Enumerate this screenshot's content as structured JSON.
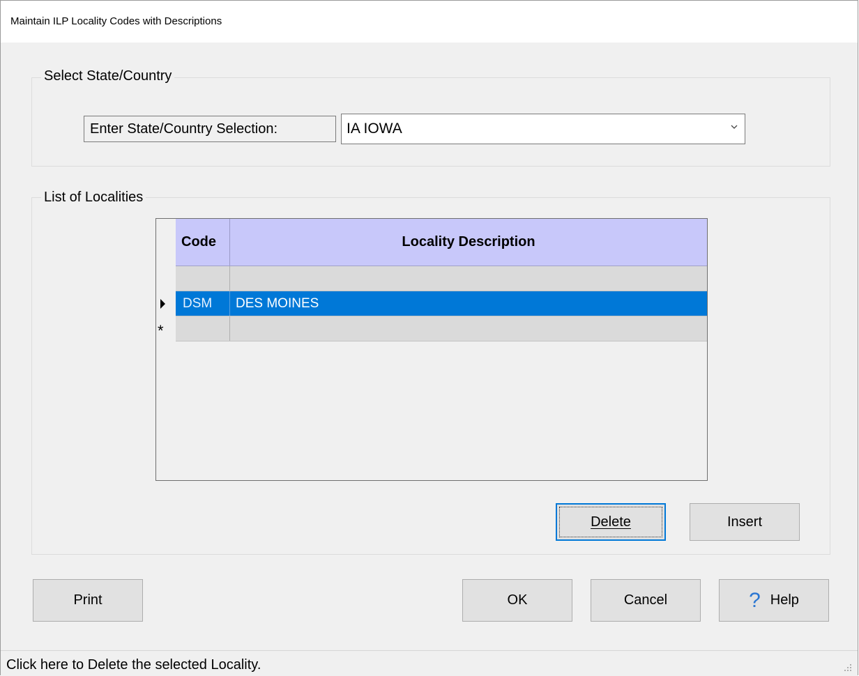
{
  "window": {
    "title": "Maintain ILP Locality Codes with Descriptions"
  },
  "select_group": {
    "caption": "Select State/Country",
    "field_label": "Enter State/Country Selection:",
    "selected_value": "IA IOWA"
  },
  "localities_group": {
    "caption": "List of Localities",
    "columns": [
      "Code",
      "Locality Description"
    ],
    "rows": [
      {
        "code": "",
        "description": ""
      },
      {
        "code": "DSM",
        "description": "DES MOINES"
      },
      {
        "code": "",
        "description": ""
      }
    ],
    "new_row_marker": "*",
    "delete_label": "Delete",
    "insert_label": "Insert"
  },
  "buttons": {
    "print": "Print",
    "ok": "OK",
    "cancel": "Cancel",
    "help": "Help",
    "help_icon_glyph": "?"
  },
  "status": {
    "text": "Click here to Delete the selected Locality."
  },
  "colors": {
    "header_bg": "#c8c8fa",
    "selected_row_bg": "#0078d7",
    "help_icon": "#2a76d2"
  }
}
